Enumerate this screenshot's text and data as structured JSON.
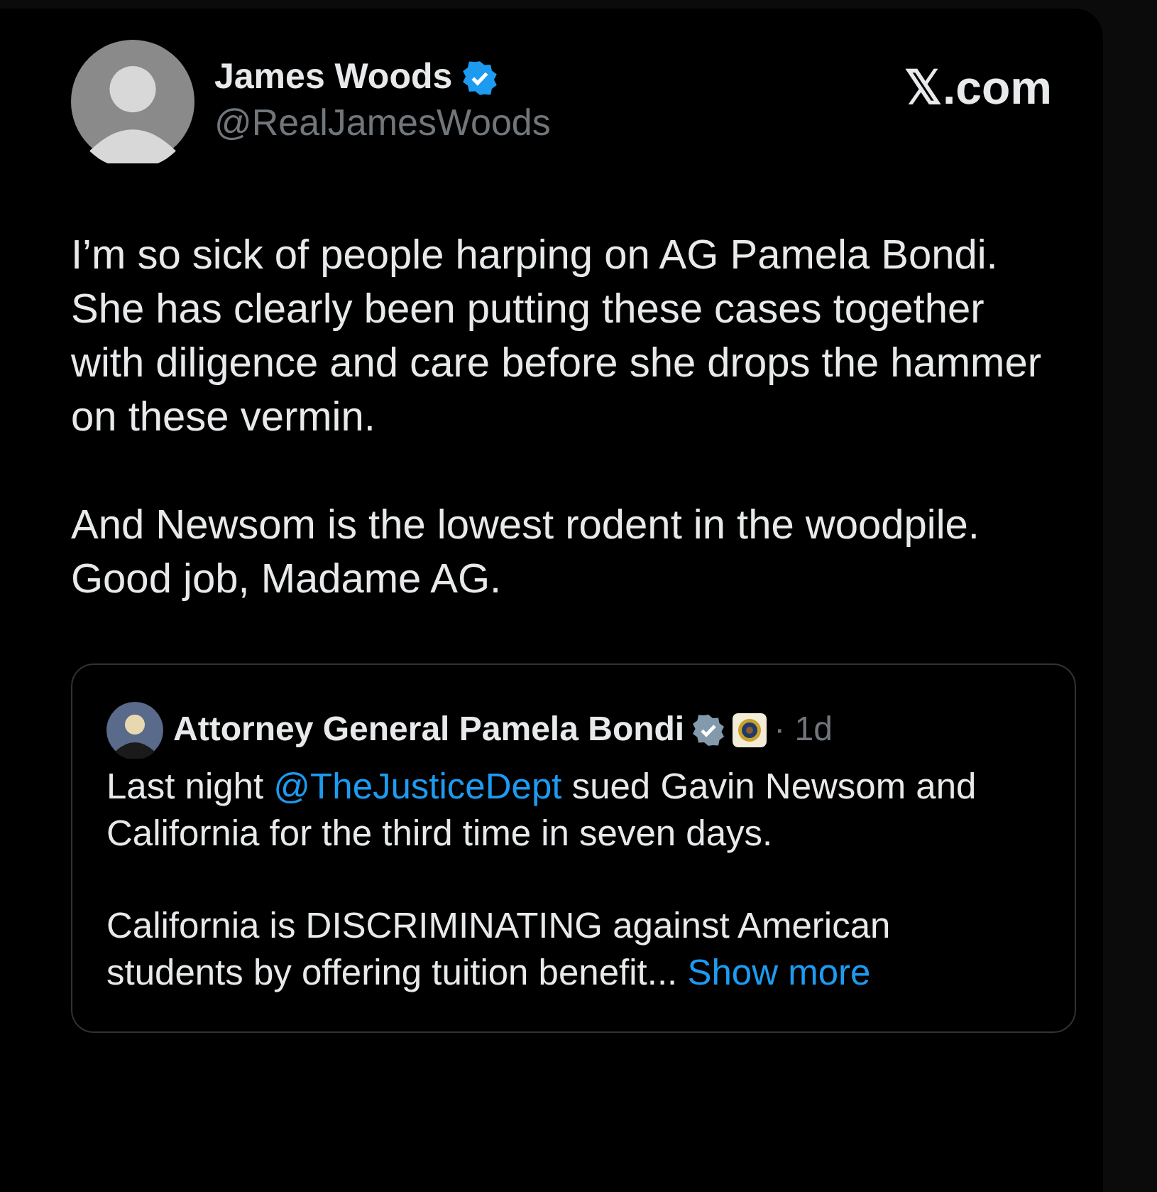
{
  "post": {
    "author": {
      "name": "James Woods",
      "handle": "@RealJamesWoods",
      "verified": true
    },
    "site": "𝕏.com",
    "paragraphs": [
      "I’m so sick of people harping on AG Pamela Bondi. She has clearly been putting these cases together with diligence and care before she drops the hammer on these vermin.",
      "And Newsom is the lowest rodent in the woodpile.  Good job, Madame AG."
    ],
    "quote": {
      "author": {
        "name": "Attorney General Pamela Bondi",
        "verified": true,
        "government": true,
        "affiliation": true
      },
      "time": "· 1d",
      "intro": {
        "before": "Last night ",
        "mention": "@TheJusticeDept",
        "after": " sued Gavin Newsom and California for the third time in seven days."
      },
      "body": "California is DISCRIMINATING against American students by offering tuition benefit...",
      "show_more": "Show more"
    }
  }
}
